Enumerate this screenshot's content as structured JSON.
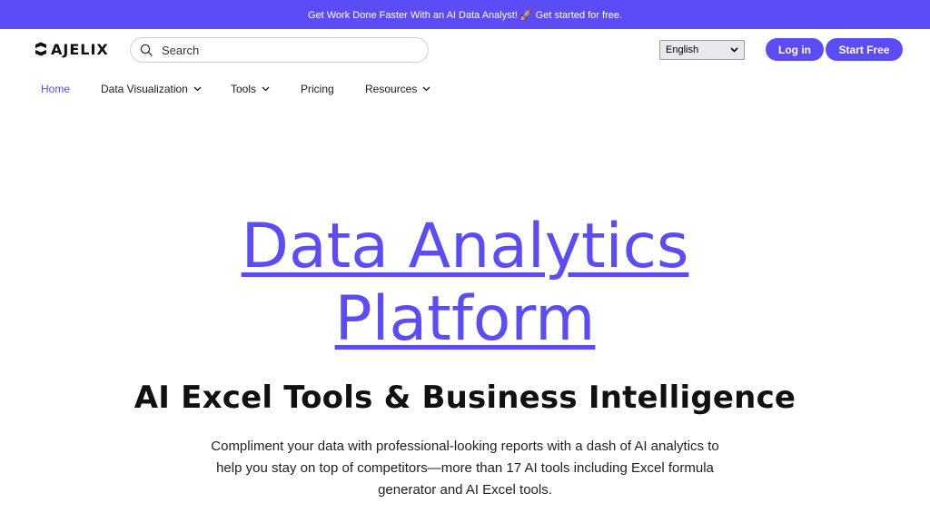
{
  "promo": {
    "text": "Get Work Done Faster With an AI Data Analyst! 🚀 Get started for free."
  },
  "header": {
    "logo_text": "AJELIX",
    "search_placeholder": "Search",
    "language": "English",
    "login_label": "Log in",
    "start_label": "Start Free"
  },
  "nav": {
    "items": [
      {
        "label": "Home",
        "active": true,
        "dropdown": false
      },
      {
        "label": "Data Visualization",
        "active": false,
        "dropdown": true
      },
      {
        "label": "Tools",
        "active": false,
        "dropdown": true
      },
      {
        "label": "Pricing",
        "active": false,
        "dropdown": false
      },
      {
        "label": "Resources",
        "active": false,
        "dropdown": true
      }
    ]
  },
  "hero": {
    "title_line1": "Data Analytics",
    "title_line2": "Platform",
    "subtitle": "AI Excel Tools & Business Intelligence",
    "description": "Compliment your data with professional-looking reports with a dash of AI analytics to help you stay on top of competitors—more than 17 AI tools including Excel formula generator and AI Excel tools."
  },
  "colors": {
    "brand": "#5b4cf5",
    "text": "#111111",
    "background": "#ffffff"
  },
  "icons": {
    "search": "search-icon",
    "dropdown": "chevron-down-icon",
    "select_arrow": "chevron-down-icon"
  }
}
